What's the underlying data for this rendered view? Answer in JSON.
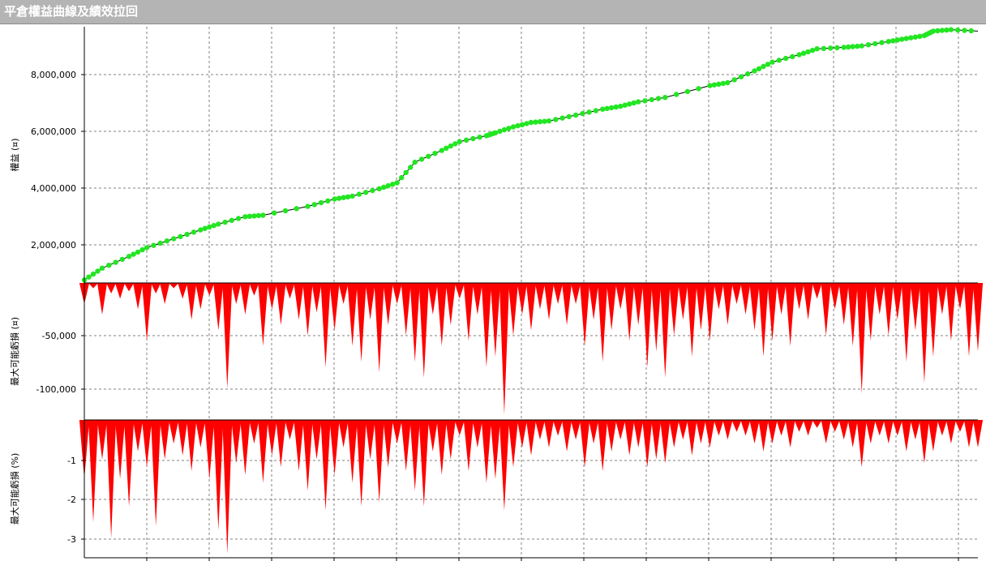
{
  "window": {
    "title": "平倉權益曲線及績效拉回"
  },
  "colors": {
    "equity_marker": "#22e622",
    "equity_line": "#000000",
    "drawdown_fill": "#ff0000",
    "grid": "#808080",
    "titlebar": "#b4b4b4"
  },
  "chart_data": [
    {
      "type": "line",
      "ylabel": "權益 (¤)",
      "ytick_labels": [
        "8,000,000",
        "6,000,000",
        "4,000,000",
        "2,000,000"
      ],
      "ylim": [
        700000,
        9400000
      ],
      "x_range": [
        0,
        100
      ],
      "series": [
        {
          "x": [
            0,
            2,
            5,
            7,
            10,
            13,
            15,
            18,
            20,
            25,
            28,
            30,
            33,
            35,
            37,
            40,
            42,
            45,
            46,
            48,
            50,
            52,
            55,
            58,
            60,
            62,
            65,
            70,
            72,
            75,
            77,
            80,
            82,
            85,
            87,
            90,
            92,
            94,
            95,
            97,
            100
          ],
          "values": [
            800000,
            1200000,
            1600000,
            1900000,
            2200000,
            2500000,
            2700000,
            2950000,
            3000000,
            3300000,
            3550000,
            3650000,
            3900000,
            4100000,
            4800000,
            5200000,
            5500000,
            5700000,
            5800000,
            6000000,
            6150000,
            6200000,
            6400000,
            6600000,
            6700000,
            6850000,
            7000000,
            7400000,
            7500000,
            7900000,
            8200000,
            8450000,
            8650000,
            8700000,
            8750000,
            8900000,
            9000000,
            9100000,
            9250000,
            9300000,
            9250000
          ]
        }
      ]
    },
    {
      "type": "area",
      "ylabel": "最大可能虧損 (¤)",
      "ytick_labels": [
        "-50,000",
        "-100,000"
      ],
      "ylim": [
        -130000,
        0
      ],
      "x_range": [
        0,
        100
      ],
      "series": [
        {
          "x": [
            0,
            1,
            2,
            3,
            4,
            5,
            6,
            7,
            8,
            9,
            10,
            11,
            12,
            13,
            14,
            15,
            16,
            17,
            18,
            19,
            20,
            21,
            22,
            23,
            24,
            25,
            26,
            27,
            28,
            29,
            30,
            31,
            32,
            33,
            34,
            35,
            36,
            37,
            38,
            39,
            40,
            41,
            42,
            43,
            44,
            45,
            46,
            47,
            48,
            49,
            50,
            51,
            52,
            53,
            54,
            55,
            56,
            57,
            58,
            59,
            60,
            61,
            62,
            63,
            64,
            65,
            66,
            67,
            68,
            69,
            70,
            71,
            72,
            73,
            74,
            75,
            76,
            77,
            78,
            79,
            80,
            81,
            82,
            83,
            84,
            85,
            86,
            87,
            88,
            89,
            90,
            91,
            92,
            93,
            94,
            95,
            96,
            97,
            98,
            99,
            100
          ],
          "values": [
            -20000,
            -5000,
            -30000,
            -10000,
            -15000,
            -8000,
            -25000,
            -55000,
            -10000,
            -20000,
            -5000,
            -15000,
            -35000,
            -25000,
            -12000,
            -45000,
            -100000,
            -20000,
            -30000,
            -12000,
            -60000,
            -25000,
            -40000,
            -15000,
            -35000,
            -50000,
            -28000,
            -80000,
            -45000,
            -20000,
            -60000,
            -75000,
            -35000,
            -85000,
            -40000,
            -20000,
            -50000,
            -75000,
            -90000,
            -30000,
            -60000,
            -40000,
            -15000,
            -55000,
            -30000,
            -80000,
            -70000,
            -125000,
            -50000,
            -30000,
            -45000,
            -25000,
            -35000,
            -20000,
            -40000,
            -20000,
            -60000,
            -35000,
            -75000,
            -45000,
            -25000,
            -55000,
            -40000,
            -80000,
            -65000,
            -90000,
            -50000,
            -35000,
            -70000,
            -45000,
            -55000,
            -25000,
            -40000,
            -20000,
            -30000,
            -45000,
            -70000,
            -55000,
            -30000,
            -60000,
            -25000,
            -35000,
            -15000,
            -50000,
            -25000,
            -40000,
            -60000,
            -105000,
            -55000,
            -30000,
            -50000,
            -35000,
            -75000,
            -45000,
            -95000,
            -70000,
            -30000,
            -55000,
            -25000,
            -70000,
            -65000
          ]
        }
      ]
    },
    {
      "type": "area",
      "ylabel": "最大可能虧損 (%)",
      "ytick_labels": [
        "-1",
        "-2",
        "-3"
      ],
      "ylim": [
        -3.5,
        0
      ],
      "x_range": [
        0,
        100
      ],
      "series": [
        {
          "x": [
            0,
            1,
            2,
            3,
            4,
            5,
            6,
            7,
            8,
            9,
            10,
            11,
            12,
            13,
            14,
            15,
            16,
            17,
            18,
            19,
            20,
            21,
            22,
            23,
            24,
            25,
            26,
            27,
            28,
            29,
            30,
            31,
            32,
            33,
            34,
            35,
            36,
            37,
            38,
            39,
            40,
            41,
            42,
            43,
            44,
            45,
            46,
            47,
            48,
            49,
            50,
            51,
            52,
            53,
            54,
            55,
            56,
            57,
            58,
            59,
            60,
            61,
            62,
            63,
            64,
            65,
            66,
            67,
            68,
            69,
            70,
            71,
            72,
            73,
            74,
            75,
            76,
            77,
            78,
            79,
            80,
            81,
            82,
            83,
            84,
            85,
            86,
            87,
            88,
            89,
            90,
            91,
            92,
            93,
            94,
            95,
            96,
            97,
            98,
            99,
            100
          ],
          "values": [
            -1.5,
            -2.6,
            -1.0,
            -3.0,
            -1.5,
            -2.2,
            -0.8,
            -1.2,
            -2.7,
            -1.0,
            -0.6,
            -0.9,
            -1.3,
            -0.7,
            -1.5,
            -2.8,
            -3.4,
            -1.1,
            -1.4,
            -0.6,
            -1.6,
            -0.9,
            -1.2,
            -0.5,
            -1.3,
            -1.8,
            -1.0,
            -2.3,
            -1.4,
            -0.7,
            -1.6,
            -2.2,
            -1.0,
            -2.1,
            -1.2,
            -0.6,
            -1.3,
            -1.8,
            -2.2,
            -0.8,
            -1.4,
            -1.0,
            -0.4,
            -1.3,
            -0.7,
            -1.6,
            -1.5,
            -2.3,
            -1.2,
            -0.7,
            -0.9,
            -0.5,
            -0.7,
            -0.4,
            -0.8,
            -0.5,
            -1.2,
            -0.6,
            -1.3,
            -0.8,
            -0.5,
            -0.9,
            -0.7,
            -1.2,
            -1.0,
            -1.1,
            -0.7,
            -0.5,
            -0.9,
            -0.6,
            -0.7,
            -0.4,
            -0.5,
            -0.3,
            -0.4,
            -0.6,
            -0.8,
            -0.6,
            -0.4,
            -0.7,
            -0.3,
            -0.4,
            -0.2,
            -0.6,
            -0.3,
            -0.5,
            -0.7,
            -1.2,
            -0.6,
            -0.4,
            -0.6,
            -0.4,
            -0.8,
            -0.5,
            -1.1,
            -0.8,
            -0.4,
            -0.6,
            -0.3,
            -0.7,
            -0.7
          ]
        }
      ]
    }
  ]
}
